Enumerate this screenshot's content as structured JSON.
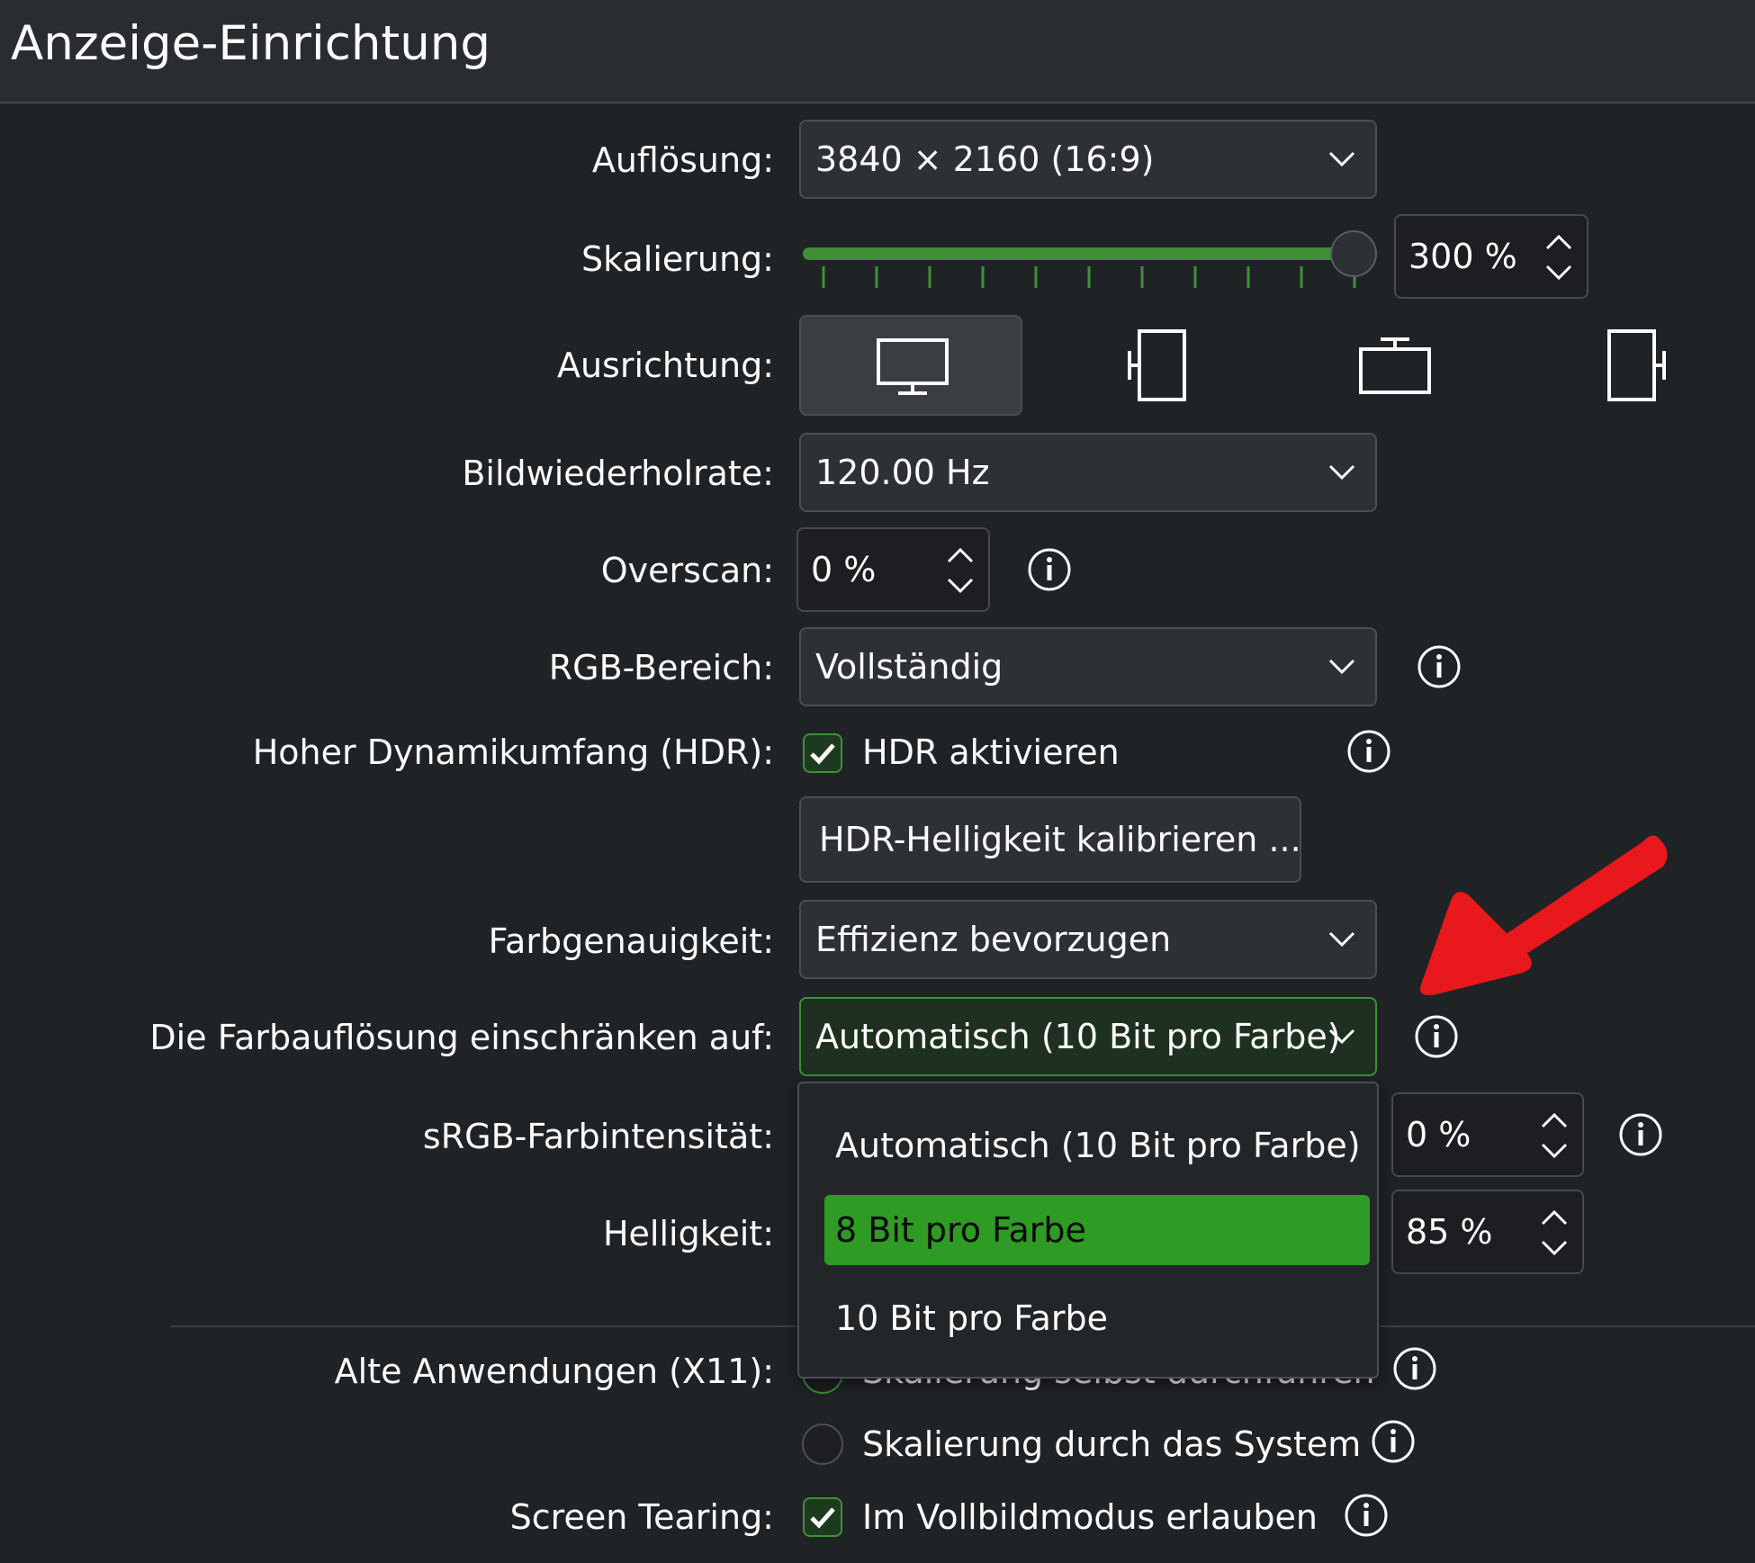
{
  "title": "Anzeige-Einrichtung",
  "colors": {
    "accent": "#3f8f39",
    "selection": "#2e9b24",
    "arrow": "#e8181c",
    "background": "#202326"
  },
  "rows": {
    "resolution": {
      "label": "Auflösung:",
      "value": "3840 × 2160 (16:9)"
    },
    "scale": {
      "label": "Skalierung:",
      "value": "300 %",
      "slider_fraction": 1.0,
      "ticks": 11
    },
    "orientation": {
      "label": "Ausrichtung:",
      "selected": "landscape",
      "options": [
        "landscape-icon",
        "portrait-left-icon",
        "landscape-flipped-icon",
        "portrait-right-icon"
      ]
    },
    "refresh_rate": {
      "label": "Bildwiederholrate:",
      "value": "120.00 Hz"
    },
    "overscan": {
      "label": "Overscan:",
      "value": "0 %"
    },
    "rgb_range": {
      "label": "RGB-Bereich:",
      "value": "Vollständig"
    },
    "hdr": {
      "label": "Hoher Dynamikumfang (HDR):",
      "checkbox_label": "HDR aktivieren",
      "checked": true,
      "calibrate_button": "HDR-Helligkeit kalibrieren ..."
    },
    "color_accuracy": {
      "label": "Farbgenauigkeit:",
      "value": "Effizienz bevorzugen"
    },
    "color_depth": {
      "label": "Die Farbauflösung einschränken auf:",
      "value": "Automatisch (10 Bit pro Farbe)"
    },
    "srgb_intensity": {
      "label": "sRGB-Farbintensität:",
      "value": "0 %"
    },
    "brightness": {
      "label": "Helligkeit:",
      "value": "85 %"
    },
    "legacy_apps": {
      "label": "Alte Anwendungen (X11):",
      "option1": "Skalierung selbst durchführen",
      "option2": "Skalierung durch das System",
      "selected": "option1"
    },
    "screen_tearing": {
      "label": "Screen Tearing:",
      "checkbox_label": "Im Vollbildmodus erlauben",
      "checked": true
    }
  },
  "dropdown_popup": {
    "items": [
      "Automatisch (10 Bit pro Farbe)",
      "8 Bit pro Farbe",
      "10 Bit pro Farbe"
    ],
    "highlighted": "8 Bit pro Farbe"
  }
}
